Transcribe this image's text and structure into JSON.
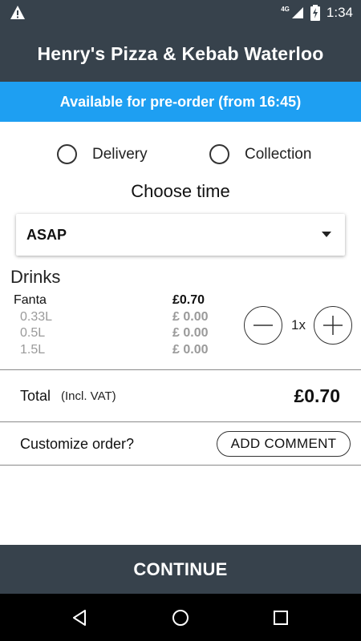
{
  "status_bar": {
    "network": "4G",
    "time": "1:34",
    "icons": [
      "warning-icon",
      "signal-icon",
      "battery-charging-icon"
    ]
  },
  "app_bar": {
    "title": "Henry's Pizza & Kebab Waterloo"
  },
  "banner": {
    "text": "Available for pre-order (from 16:45)",
    "color": "#1e9ff2"
  },
  "order_type": {
    "options": [
      {
        "label": "Delivery",
        "selected": false
      },
      {
        "label": "Collection",
        "selected": false
      }
    ]
  },
  "time_picker": {
    "heading": "Choose time",
    "selected": "ASAP"
  },
  "cart": {
    "section": "Drinks",
    "item": {
      "name": "Fanta",
      "price": "£0.70",
      "variants": [
        {
          "label": "0.33L",
          "price": "£ 0.00"
        },
        {
          "label": "0.5L",
          "price": "£ 0.00"
        },
        {
          "label": "1.5L",
          "price": "£ 0.00"
        }
      ],
      "quantity": "1x"
    }
  },
  "totals": {
    "label": "Total",
    "vat_note": "(Incl. VAT)",
    "value": "£0.70"
  },
  "customize": {
    "label": "Customize order?",
    "button": "ADD COMMENT"
  },
  "continue_button": "CONTINUE",
  "colors": {
    "app_bar": "#37424c",
    "accent": "#1e9ff2"
  }
}
